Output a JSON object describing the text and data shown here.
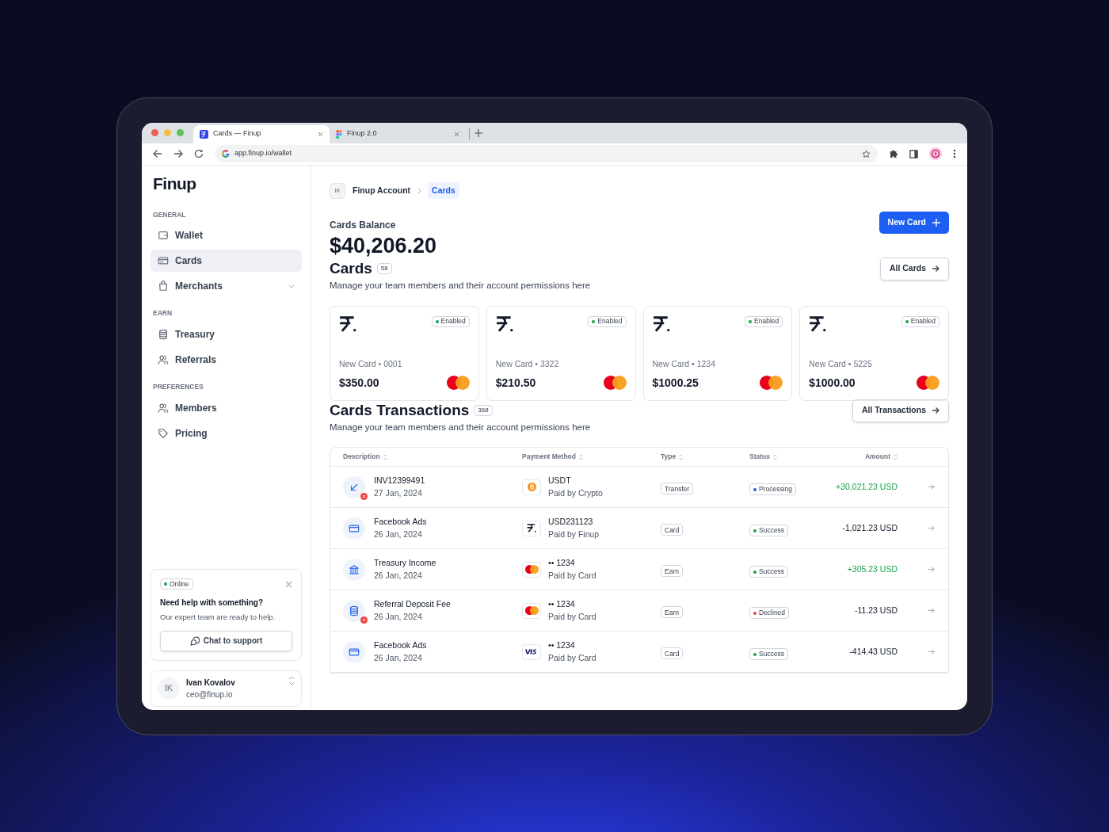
{
  "browser": {
    "tabs": [
      {
        "title": "Cards — Finup",
        "selected": true
      },
      {
        "title": "Finup 2.0",
        "selected": false
      }
    ],
    "url": "app.finup.io/wallet"
  },
  "sidebar": {
    "logo": "Finup",
    "sections": [
      {
        "heading": "GENERAL",
        "items": [
          {
            "label": "Wallet",
            "kind": "link",
            "selected": false
          },
          {
            "label": "Cards",
            "kind": "link",
            "selected": true
          },
          {
            "label": "Merchants",
            "kind": "group",
            "selected": false
          }
        ]
      },
      {
        "heading": "EARN",
        "items": [
          {
            "label": "Treasury",
            "kind": "link",
            "selected": false
          },
          {
            "label": "Referrals",
            "kind": "link",
            "selected": false
          }
        ]
      },
      {
        "heading": "PREFERENCES",
        "items": [
          {
            "label": "Members",
            "kind": "link",
            "selected": false
          },
          {
            "label": "Pricing",
            "kind": "link",
            "selected": false
          }
        ]
      }
    ],
    "help": {
      "badge": "Online",
      "title": "Need help with something?",
      "text": "Our expert team are ready to help.",
      "button": "Chat to support"
    },
    "user": {
      "initials": "IK",
      "name": "Ivan Kovalov",
      "email": "ceo@finup.io"
    }
  },
  "main": {
    "breadcrumb": {
      "avatar": "IK",
      "items": [
        {
          "label": "Finup Account",
          "selected": false
        },
        {
          "label": "Cards",
          "selected": true
        }
      ]
    },
    "balance": {
      "label": "Cards Balance",
      "amount": "$40,206.20",
      "button": "New Card"
    },
    "cards": {
      "title": "Cards",
      "count": "58",
      "subtitle": "Manage your team members and their account permissions here",
      "button": "All Cards",
      "items": [
        {
          "status": "Enabled",
          "name": "New Card • 0001",
          "amount": "$350.00"
        },
        {
          "status": "Enabled",
          "name": "New Card • 3322",
          "amount": "$210.50"
        },
        {
          "status": "Enabled",
          "name": "New Card • 1234",
          "amount": "$1000.25"
        },
        {
          "status": "Enabled",
          "name": "New Card • 5225",
          "amount": "$1000.00"
        }
      ]
    },
    "transactions": {
      "title": "Cards Transactions",
      "count": "368",
      "subtitle": "Manage your team members and their account permissions here",
      "button": "All Transactions",
      "columns": [
        "Description",
        "Payment Method",
        "Type",
        "Status",
        "Amount"
      ],
      "rows": [
        {
          "error": true,
          "description": "INV12399491",
          "date": "27 Jan, 2024",
          "method": "USDT",
          "method_sub": "Paid by Crypto",
          "type": "Transfer",
          "status": "Processing",
          "color": "#2563eb",
          "amount": "+30,021.23 USD",
          "positive": true
        },
        {
          "error": false,
          "description": "Facebook Ads",
          "date": "26 Jan, 2024",
          "method": "USD231123",
          "method_sub": "Paid by Finup",
          "type": "Card",
          "status": "Success",
          "color": "#16a34a",
          "amount": "-1,021.23 USD",
          "positive": false
        },
        {
          "error": false,
          "description": "Treasury Income",
          "date": "26 Jan, 2024",
          "method": "•• 1234",
          "method_sub": "Paid by Card",
          "type": "Earn",
          "status": "Success",
          "color": "#16a34a",
          "amount": "+305.23 USD",
          "positive": true
        },
        {
          "error": true,
          "description": "Referral Deposit Fee",
          "date": "26 Jan, 2024",
          "method": "•• 1234",
          "method_sub": "Paid by Card",
          "type": "Earn",
          "status": "Declined",
          "color": "#ef4444",
          "amount": "-11.23 USD",
          "positive": false
        },
        {
          "error": false,
          "description": "Facebook Ads",
          "date": "26 Jan, 2024",
          "method": "•• 1234",
          "method_sub": "Paid by Card",
          "type": "Card",
          "status": "Success",
          "color": "#16a34a",
          "amount": "-414.43 USD",
          "positive": false
        }
      ]
    }
  }
}
